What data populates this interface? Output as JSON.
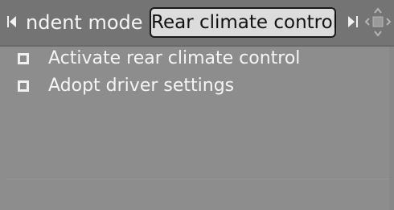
{
  "header": {
    "prev_tab_label": "ndent mode",
    "active_tab_label": "Rear climate control"
  },
  "menu": {
    "items": [
      {
        "label": "Activate rear climate control",
        "checked": false
      },
      {
        "label": "Adopt driver settings",
        "checked": false
      }
    ]
  },
  "icons": {
    "left_arrow": "tab-left-arrow-icon",
    "right_arrow": "tab-right-arrow-icon",
    "controller": "idrive-controller-icon",
    "checkbox": "checkbox-icon"
  },
  "colors": {
    "background": "#8d8d8d",
    "header_background": "#747474",
    "active_tab_background": "#dcdcdc",
    "text": "#f5f5f5",
    "active_tab_text": "#111111"
  }
}
